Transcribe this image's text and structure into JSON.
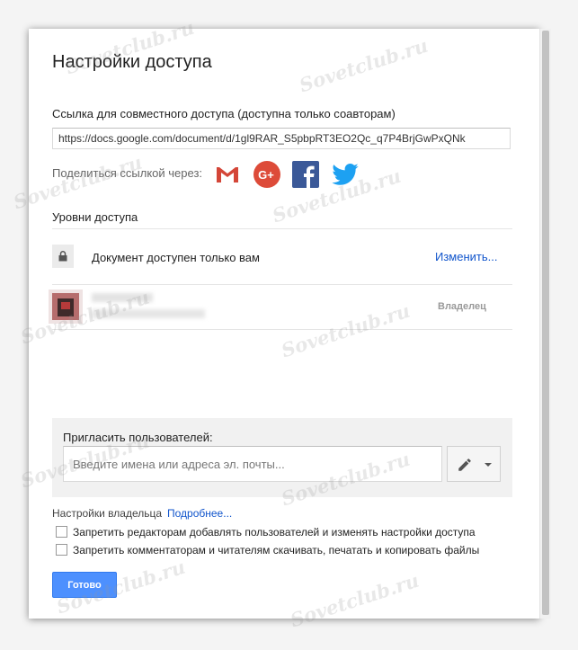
{
  "dialog": {
    "title": "Настройки доступа",
    "link_section": {
      "label": "Ссылка для совместного доступа (доступна только соавторам)",
      "url": "https://docs.google.com/document/d/1gl9RAR_S5pbpRT3EO2Qc_q7P4BrjGwPxQNk"
    },
    "share": {
      "label": "Поделиться ссылкой через:",
      "services": [
        {
          "name": "gmail-icon",
          "color": "#d44638"
        },
        {
          "name": "google-plus-icon",
          "color": "#dd4b39"
        },
        {
          "name": "facebook-icon",
          "color": "#3b5998"
        },
        {
          "name": "twitter-icon",
          "color": "#1da1f2"
        }
      ]
    },
    "access": {
      "label": "Уровни доступа",
      "status": "Документ доступен только вам",
      "change_link": "Изменить...",
      "owner_role": "Владелец"
    },
    "invite": {
      "label": "Пригласить пользователей:",
      "placeholder": "Введите имена или адреса эл. почты...",
      "permission_icon": "pencil-icon"
    },
    "owner_settings": {
      "label": "Настройки владельца",
      "more_link": "Подробнее...",
      "options": [
        {
          "label": "Запретить редакторам добавлять пользователей и изменять настройки доступа",
          "checked": false
        },
        {
          "label": "Запретить комментаторам и читателям скачивать, печатать и копировать файлы",
          "checked": false
        }
      ]
    },
    "done_button": "Готово"
  },
  "watermark": "Sovetclub.ru",
  "colors": {
    "accent": "#4d90fe",
    "link": "#1155cc"
  }
}
